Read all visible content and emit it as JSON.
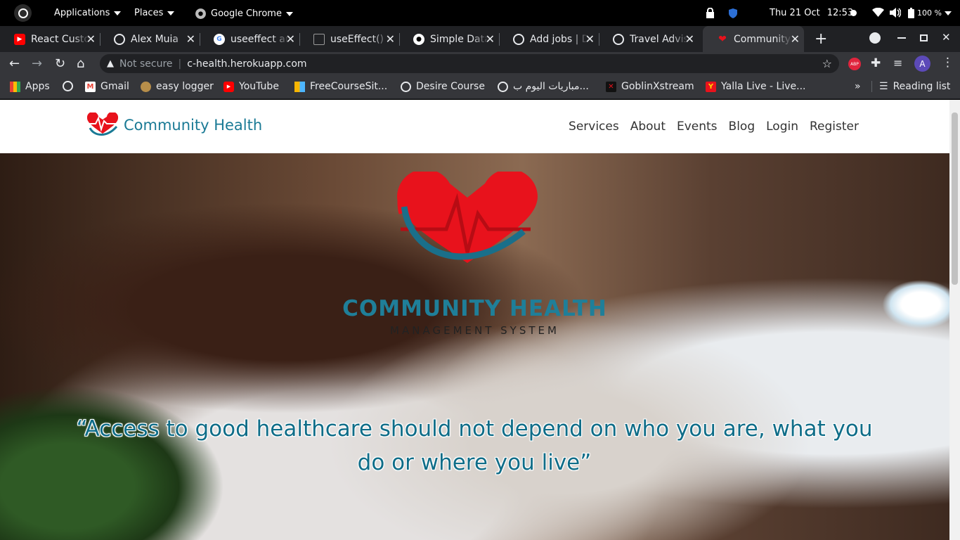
{
  "system_bar": {
    "applications": "Applications",
    "places": "Places",
    "app": "Google Chrome",
    "date": "Thu 21 Oct",
    "time": "12:53",
    "battery": "100 %"
  },
  "tabs": [
    {
      "title": "React Custom",
      "favicon": "youtube-icon",
      "color": "#ff0000"
    },
    {
      "title": "Alex Muia",
      "favicon": "globe-icon",
      "color": "#ffffff"
    },
    {
      "title": "useeffect and",
      "favicon": "google-icon",
      "color": "#4285f4"
    },
    {
      "title": "useEffect() h",
      "favicon": "codesandbox-icon",
      "color": "#999999"
    },
    {
      "title": "Simple Data",
      "favicon": "medium-icon",
      "color": "#ffffff"
    },
    {
      "title": "Add jobs | D",
      "favicon": "globe-icon",
      "color": "#ffffff"
    },
    {
      "title": "Travel Advis",
      "favicon": "globe-icon",
      "color": "#ffffff"
    },
    {
      "title": "Community H",
      "favicon": "heart-icon",
      "color": "#e8121c"
    }
  ],
  "address": {
    "security": "Not secure",
    "url": "c-health.herokuapp.com",
    "avatar": "A"
  },
  "bookmarks": [
    {
      "label": "Apps",
      "icon": "apps-grid-icon"
    },
    {
      "label": "",
      "icon": "globe-icon"
    },
    {
      "label": "Gmail",
      "icon": "gmail-icon"
    },
    {
      "label": "easy logger",
      "icon": "logger-icon"
    },
    {
      "label": "YouTube",
      "icon": "youtube-icon"
    },
    {
      "label": "FreeCourseSit...",
      "icon": "freecourse-icon"
    },
    {
      "label": "Desire Course",
      "icon": "globe-icon"
    },
    {
      "label": "مباريات اليوم ب...",
      "icon": "globe-icon"
    },
    {
      "label": "GoblinXstream",
      "icon": "goblin-icon"
    },
    {
      "label": "Yalla Live - Live...",
      "icon": "yalla-icon"
    }
  ],
  "reading_list": "Reading list",
  "site": {
    "brand": "Community Health",
    "nav": [
      "Services",
      "About",
      "Events",
      "Blog",
      "Login",
      "Register"
    ],
    "hero_title": "COMMUNITY HEALTH",
    "hero_subtitle": "MANAGEMENT SYSTEM",
    "quote": "“Access to good healthcare should not depend on who you are, what you do or where you live”"
  },
  "colors": {
    "brand": "#1a7a95",
    "heart": "#e8121c"
  }
}
